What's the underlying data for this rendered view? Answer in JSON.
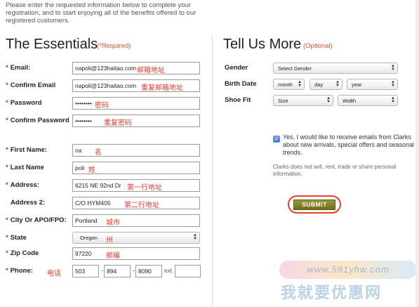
{
  "intro": "Please enter the requested information below to complete your registration, and to start enjoying all of the benefits offered to our registered customers.",
  "essentials": {
    "title": "The Essentials",
    "note": "(*Required)",
    "email_label": "Email:",
    "email_value": "napoli@123haitao.com",
    "email_anno": "邮箱地址",
    "confirm_email_label": "Confirm Email",
    "confirm_email_value": "napoli@123haitao.com",
    "confirm_email_anno": "重复邮箱地址",
    "password_label": "Password",
    "password_value": "••••••••",
    "password_anno": "密码",
    "confirm_password_label": "Confirm Password",
    "confirm_password_value": "••••••••",
    "confirm_password_anno": "重复密码",
    "first_name_label": "First Name:",
    "first_name_value": "na",
    "first_name_anno": "名",
    "last_name_label": "Last Name",
    "last_name_value": "poli",
    "last_name_anno": "姓",
    "address_label": "Address:",
    "address_value": "6215 NE 92nd Dr",
    "address_anno": "第一行地址",
    "address2_label": "Address 2:",
    "address2_value": "C/O HYM405",
    "address2_anno": "第二行地址",
    "city_label": "City Or APO/FPO:",
    "city_value": "Portland",
    "city_anno": "城市",
    "state_label": "State",
    "state_value": "Oregon",
    "state_anno": "州",
    "zip_label": "Zip Code",
    "zip_value": "97220",
    "zip_anno": "邮编",
    "phone_label": "Phone:",
    "phone_anno": "电话",
    "phone_area": "503",
    "phone_prefix": "894",
    "phone_line": "8090",
    "phone_dash": "-",
    "ext_label": "ext.",
    "ext_value": ""
  },
  "more": {
    "title": "Tell Us More",
    "note": "(Optional)",
    "gender_label": "Gender",
    "gender_value": "Select Gender",
    "birth_label": "Birth Date",
    "birth_month": "month",
    "birth_day": "day",
    "birth_year": "year",
    "shoe_label": "Shoe Fit",
    "shoe_size": "Size",
    "shoe_width": "Width",
    "newsletter_checked": true,
    "newsletter_text": "Yes, I would like to receive emails from Clarks about new arrivals, special offers and seasonal trends.",
    "disclaimer": "Clarks does not sell, rent, trade or share personal information.",
    "submit_label": "SUBMIT"
  },
  "watermark": {
    "url": "www.591yhw.com",
    "name": "我就要优惠网"
  },
  "colors": {
    "required_asterisk": "#cc2b1d",
    "annotation": "#e43a2a",
    "submit_bg": "#7d7d24",
    "submit_ring": "#e6402e"
  }
}
